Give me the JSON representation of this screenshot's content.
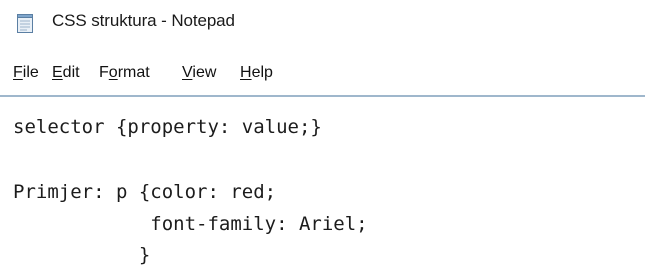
{
  "window": {
    "title": "CSS struktura - Notepad"
  },
  "menu": {
    "file": {
      "label_first": "F",
      "label_rest": "ile"
    },
    "edit": {
      "label_first": "E",
      "label_rest": "dit"
    },
    "format": {
      "label_first": "F",
      "label_pre": "F",
      "label_u": "o",
      "label_rest": "rmat"
    },
    "view": {
      "label_first": "V",
      "label_rest": "iew"
    },
    "help": {
      "label_first": "H",
      "label_rest": "elp"
    }
  },
  "editor": {
    "lines": [
      "selector {property: value;}",
      "",
      "Primjer: p {color: red;",
      "            font-family: Ariel;",
      "           }"
    ]
  },
  "colors": {
    "menu_divider": "#9fb7cc",
    "text": "#1c1c1c"
  },
  "icons": {
    "app": "notepad-icon"
  }
}
